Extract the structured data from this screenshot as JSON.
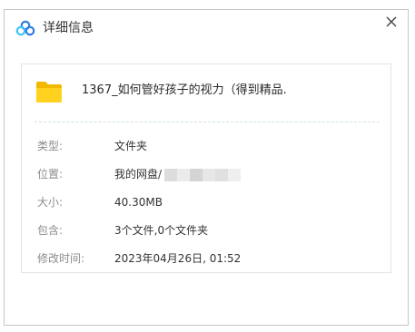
{
  "dialog": {
    "title": "详细信息",
    "close_label": "×"
  },
  "file": {
    "name": "1367_如何管好孩子的视力（得到精品.",
    "icon": "folder-icon"
  },
  "details": {
    "type_label": "类型:",
    "type_value": "文件夹",
    "location_label": "位置:",
    "location_value": "我的网盘/",
    "size_label": "大小:",
    "size_value": "40.30MB",
    "contains_label": "包含:",
    "contains_value": "3个文件,0个文件夹",
    "modified_label": "修改时间:",
    "modified_value": "2023年04月26日, 01:52"
  },
  "colors": {
    "folder": "#f5c400",
    "logo_blue": "#2f7de1",
    "logo_cyan": "#3ec3f2"
  }
}
